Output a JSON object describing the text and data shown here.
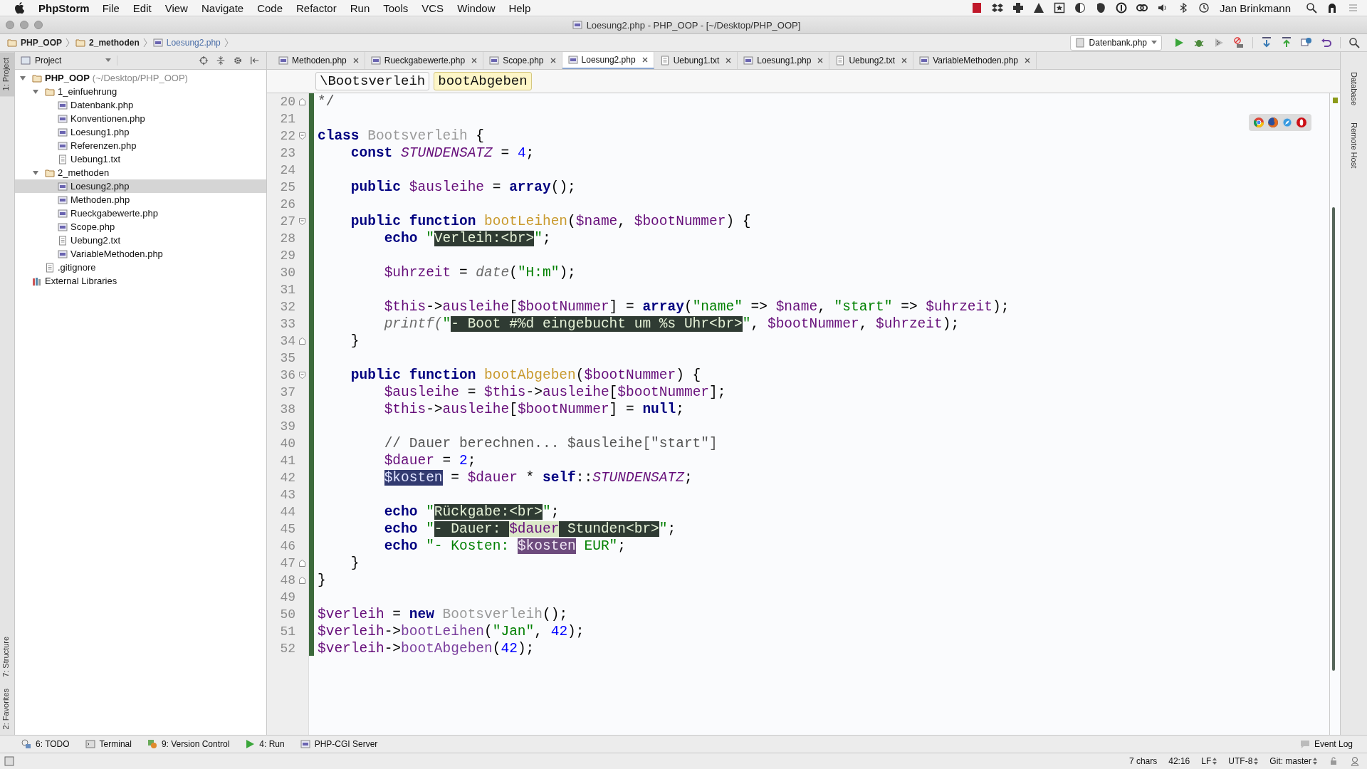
{
  "menu_bar": {
    "app": "PhpStorm",
    "items": [
      "File",
      "Edit",
      "View",
      "Navigate",
      "Code",
      "Refactor",
      "Run",
      "Tools",
      "VCS",
      "Window",
      "Help"
    ],
    "user": "Jan Brinkmann"
  },
  "window": {
    "title": "Loesung2.php - PHP_OOP - [~/Desktop/PHP_OOP]"
  },
  "breadcrumb": [
    {
      "label": "PHP_OOP",
      "kind": "folder"
    },
    {
      "label": "2_methoden",
      "kind": "folder"
    },
    {
      "label": "Loesung2.php",
      "kind": "php"
    }
  ],
  "run_config": "Datenbank.php",
  "project_panel": {
    "title": "Project",
    "tree": [
      {
        "label": "PHP_OOP",
        "hint": "(~/Desktop/PHP_OOP)",
        "kind": "root",
        "expanded": true,
        "selected": false,
        "children": [
          {
            "label": "1_einfuehrung",
            "kind": "folder",
            "expanded": true,
            "selected": false,
            "children": [
              {
                "label": "Datenbank.php",
                "kind": "php",
                "selected": false
              },
              {
                "label": "Konventionen.php",
                "kind": "php",
                "selected": false
              },
              {
                "label": "Loesung1.php",
                "kind": "php",
                "selected": false
              },
              {
                "label": "Referenzen.php",
                "kind": "php",
                "selected": false
              },
              {
                "label": "Uebung1.txt",
                "kind": "txt",
                "selected": false
              }
            ]
          },
          {
            "label": "2_methoden",
            "kind": "folder",
            "expanded": true,
            "selected": false,
            "children": [
              {
                "label": "Loesung2.php",
                "kind": "php",
                "selected": true
              },
              {
                "label": "Methoden.php",
                "kind": "php",
                "selected": false
              },
              {
                "label": "Rueckgabewerte.php",
                "kind": "php",
                "selected": false
              },
              {
                "label": "Scope.php",
                "kind": "php",
                "selected": false
              },
              {
                "label": "Uebung2.txt",
                "kind": "txt",
                "selected": false
              },
              {
                "label": "VariableMethoden.php",
                "kind": "php",
                "selected": false
              }
            ]
          },
          {
            "label": ".gitignore",
            "kind": "txt",
            "selected": false
          }
        ]
      },
      {
        "label": "External Libraries",
        "kind": "libs",
        "selected": false
      }
    ]
  },
  "side_tabs_left": [
    {
      "label": "1: Project",
      "selected": true
    },
    {
      "label": "7: Structure",
      "selected": false
    },
    {
      "label": "2: Favorites",
      "selected": false
    }
  ],
  "side_tabs_right": [
    "Database",
    "Remote Host"
  ],
  "tabs": [
    {
      "label": "Methoden.php",
      "kind": "php",
      "selected": false
    },
    {
      "label": "Rueckgabewerte.php",
      "kind": "php",
      "selected": false
    },
    {
      "label": "Scope.php",
      "kind": "php",
      "selected": false
    },
    {
      "label": "Loesung2.php",
      "kind": "php",
      "selected": true
    },
    {
      "label": "Uebung1.txt",
      "kind": "txt",
      "selected": false
    },
    {
      "label": "Loesung1.php",
      "kind": "php",
      "selected": false
    },
    {
      "label": "Uebung2.txt",
      "kind": "txt",
      "selected": false
    },
    {
      "label": "VariableMethoden.php",
      "kind": "php",
      "selected": false
    }
  ],
  "editor": {
    "breadcrumb": [
      {
        "label": "\\Bootsverleih",
        "selected": false
      },
      {
        "label": "bootAbgeben",
        "selected": true
      }
    ],
    "lines": [
      {
        "number": "20",
        "fold_end": true,
        "tokens": [
          {
            "text": "*/",
            "kind": "cmt"
          }
        ]
      },
      {
        "number": "21"
      },
      {
        "number": "22",
        "fold_start": true,
        "tokens": [
          {
            "text": "class ",
            "kind": "kw"
          },
          {
            "text": "Bootsverleih",
            "kind": "cls"
          },
          {
            "text": " {",
            "kind": "p"
          }
        ]
      },
      {
        "number": "23",
        "tokens": [
          {
            "text": "    const ",
            "kind": "kw"
          },
          {
            "text": "STUNDENSATZ",
            "kind": "const"
          },
          {
            "text": " = ",
            "kind": "p"
          },
          {
            "text": "4",
            "kind": "num"
          },
          {
            "text": ";",
            "kind": "p"
          }
        ]
      },
      {
        "number": "24"
      },
      {
        "number": "25",
        "tokens": [
          {
            "text": "    public ",
            "kind": "kw"
          },
          {
            "text": "$ausleihe",
            "kind": "var"
          },
          {
            "text": " = ",
            "kind": "p"
          },
          {
            "text": "array",
            "kind": "kw"
          },
          {
            "text": "();",
            "kind": "p"
          }
        ]
      },
      {
        "number": "26"
      },
      {
        "number": "27",
        "fold_start": true,
        "tokens": [
          {
            "text": "    public function ",
            "kind": "kw"
          },
          {
            "text": "bootLeihen",
            "kind": "fn"
          },
          {
            "text": "(",
            "kind": "p"
          },
          {
            "text": "$name",
            "kind": "var"
          },
          {
            "text": ", ",
            "kind": "p"
          },
          {
            "text": "$bootNummer",
            "kind": "var"
          },
          {
            "text": ") {",
            "kind": "p"
          }
        ]
      },
      {
        "number": "28",
        "tokens": [
          {
            "text": "        echo ",
            "kind": "kw"
          },
          {
            "text": "\"",
            "kind": "str"
          },
          {
            "text": "Verleih:<br>",
            "kind": "hl"
          },
          {
            "text": "\"",
            "kind": "str"
          },
          {
            "text": ";",
            "kind": "p"
          }
        ]
      },
      {
        "number": "29"
      },
      {
        "number": "30",
        "tokens": [
          {
            "text": "        $uhrzeit",
            "kind": "var"
          },
          {
            "text": " = ",
            "kind": "p"
          },
          {
            "text": "date",
            "kind": "bi"
          },
          {
            "text": "(",
            "kind": "p"
          },
          {
            "text": "\"H:m\"",
            "kind": "str"
          },
          {
            "text": ");",
            "kind": "p"
          }
        ]
      },
      {
        "number": "31"
      },
      {
        "number": "32",
        "tokens": [
          {
            "text": "        $this",
            "kind": "var"
          },
          {
            "text": "->",
            "kind": "p"
          },
          {
            "text": "ausleihe",
            "kind": "var"
          },
          {
            "text": "[",
            "kind": "p"
          },
          {
            "text": "$bootNummer",
            "kind": "var"
          },
          {
            "text": "] = ",
            "kind": "p"
          },
          {
            "text": "array",
            "kind": "kw"
          },
          {
            "text": "(",
            "kind": "p"
          },
          {
            "text": "\"name\"",
            "kind": "str"
          },
          {
            "text": " => ",
            "kind": "p"
          },
          {
            "text": "$name",
            "kind": "var"
          },
          {
            "text": ", ",
            "kind": "p"
          },
          {
            "text": "\"start\"",
            "kind": "str"
          },
          {
            "text": " => ",
            "kind": "p"
          },
          {
            "text": "$uhrzeit",
            "kind": "var"
          },
          {
            "text": ");",
            "kind": "p"
          }
        ]
      },
      {
        "number": "33",
        "tokens": [
          {
            "text": "        printf(",
            "kind": "bi"
          },
          {
            "text": "\"",
            "kind": "str"
          },
          {
            "text": "- Boot #%d eingebucht um %s Uhr<br>",
            "kind": "hl"
          },
          {
            "text": "\"",
            "kind": "str"
          },
          {
            "text": ", ",
            "kind": "p"
          },
          {
            "text": "$bootNummer",
            "kind": "var"
          },
          {
            "text": ", ",
            "kind": "p"
          },
          {
            "text": "$uhrzeit",
            "kind": "var"
          },
          {
            "text": ");",
            "kind": "p"
          }
        ]
      },
      {
        "number": "34",
        "fold_end": true,
        "tokens": [
          {
            "text": "    }",
            "kind": "p"
          }
        ]
      },
      {
        "number": "35"
      },
      {
        "number": "36",
        "fold_start": true,
        "tokens": [
          {
            "text": "    public function ",
            "kind": "kw"
          },
          {
            "text": "bootAbgeben",
            "kind": "fn"
          },
          {
            "text": "(",
            "kind": "p"
          },
          {
            "text": "$bootNummer",
            "kind": "var"
          },
          {
            "text": ") {",
            "kind": "p"
          }
        ]
      },
      {
        "number": "37",
        "tokens": [
          {
            "text": "        $ausleihe",
            "kind": "var"
          },
          {
            "text": " = ",
            "kind": "p"
          },
          {
            "text": "$this",
            "kind": "var"
          },
          {
            "text": "->",
            "kind": "p"
          },
          {
            "text": "ausleihe",
            "kind": "var"
          },
          {
            "text": "[",
            "kind": "p"
          },
          {
            "text": "$bootNummer",
            "kind": "var"
          },
          {
            "text": "];",
            "kind": "p"
          }
        ]
      },
      {
        "number": "38",
        "tokens": [
          {
            "text": "        $this",
            "kind": "var"
          },
          {
            "text": "->",
            "kind": "p"
          },
          {
            "text": "ausleihe",
            "kind": "var"
          },
          {
            "text": "[",
            "kind": "p"
          },
          {
            "text": "$bootNummer",
            "kind": "var"
          },
          {
            "text": "] = ",
            "kind": "p"
          },
          {
            "text": "null",
            "kind": "kw"
          },
          {
            "text": ";",
            "kind": "p"
          }
        ]
      },
      {
        "number": "39"
      },
      {
        "number": "40",
        "tokens": [
          {
            "text": "        // Dauer berechnen... $ausleihe[\"start\"]",
            "kind": "cmt"
          }
        ]
      },
      {
        "number": "41",
        "tokens": [
          {
            "text": "        $dauer",
            "kind": "var"
          },
          {
            "text": " = ",
            "kind": "p"
          },
          {
            "text": "2",
            "kind": "num"
          },
          {
            "text": ";",
            "kind": "p"
          }
        ]
      },
      {
        "number": "42",
        "tokens": [
          {
            "text": "        $kosten",
            "kind": "sel"
          },
          {
            "text": " = ",
            "kind": "p"
          },
          {
            "text": "$dauer",
            "kind": "var"
          },
          {
            "text": " * ",
            "kind": "p"
          },
          {
            "text": "self",
            "kind": "kw"
          },
          {
            "text": "::",
            "kind": "p"
          },
          {
            "text": "STUNDENSATZ",
            "kind": "const"
          },
          {
            "text": ";",
            "kind": "p"
          }
        ]
      },
      {
        "number": "43"
      },
      {
        "number": "44",
        "tokens": [
          {
            "text": "        echo ",
            "kind": "kw"
          },
          {
            "text": "\"",
            "kind": "str"
          },
          {
            "text": "Rückgabe:<br>",
            "kind": "hl"
          },
          {
            "text": "\"",
            "kind": "str"
          },
          {
            "text": ";",
            "kind": "p"
          }
        ]
      },
      {
        "number": "45",
        "tokens": [
          {
            "text": "        echo ",
            "kind": "kw"
          },
          {
            "text": "\"",
            "kind": "str"
          },
          {
            "text": "- Dauer: ",
            "kind": "hl"
          },
          {
            "text": "$dauer",
            "kind": "instr"
          },
          {
            "text": " Stunden<br>",
            "kind": "hl"
          },
          {
            "text": "\"",
            "kind": "str"
          },
          {
            "text": ";",
            "kind": "p"
          }
        ]
      },
      {
        "number": "46",
        "tokens": [
          {
            "text": "        echo ",
            "kind": "kw"
          },
          {
            "text": "\"- Kosten: ",
            "kind": "str"
          },
          {
            "text": "$kosten",
            "kind": "sel2"
          },
          {
            "text": " EUR\"",
            "kind": "str"
          },
          {
            "text": ";",
            "kind": "p"
          }
        ]
      },
      {
        "number": "47",
        "fold_end": true,
        "tokens": [
          {
            "text": "    }",
            "kind": "p"
          }
        ]
      },
      {
        "number": "48",
        "fold_end": true,
        "tokens": [
          {
            "text": "}",
            "kind": "p"
          }
        ]
      },
      {
        "number": "49"
      },
      {
        "number": "50",
        "tokens": [
          {
            "text": "$verleih",
            "kind": "var"
          },
          {
            "text": " = ",
            "kind": "p"
          },
          {
            "text": "new ",
            "kind": "kw"
          },
          {
            "text": "Bootsverleih",
            "kind": "cls"
          },
          {
            "text": "();",
            "kind": "p"
          }
        ]
      },
      {
        "number": "51",
        "tokens": [
          {
            "text": "$verleih",
            "kind": "var"
          },
          {
            "text": "->",
            "kind": "p"
          },
          {
            "text": "bootLeihen",
            "kind": "call"
          },
          {
            "text": "(",
            "kind": "p"
          },
          {
            "text": "\"Jan\"",
            "kind": "str"
          },
          {
            "text": ", ",
            "kind": "p"
          },
          {
            "text": "42",
            "kind": "num"
          },
          {
            "text": ");",
            "kind": "p"
          }
        ]
      },
      {
        "number": "52",
        "tokens": [
          {
            "text": "$verleih",
            "kind": "var"
          },
          {
            "text": "->",
            "kind": "p"
          },
          {
            "text": "bootAbgeben",
            "kind": "call"
          },
          {
            "text": "(",
            "kind": "p"
          },
          {
            "text": "42",
            "kind": "num"
          },
          {
            "text": ");",
            "kind": "p"
          }
        ]
      }
    ]
  },
  "tool_windows": [
    {
      "label": "6: TODO",
      "kind": "todo"
    },
    {
      "label": "Terminal",
      "kind": "terminal"
    },
    {
      "label": "9: Version Control",
      "kind": "vcs"
    },
    {
      "label": "4: Run",
      "kind": "run"
    },
    {
      "label": "PHP-CGI Server",
      "kind": "php"
    }
  ],
  "event_log": "Event Log",
  "status_bar": [
    {
      "label": "7 chars",
      "kind": "text"
    },
    {
      "label": "42:16",
      "kind": "text"
    },
    {
      "label": "LF",
      "kind": "select"
    },
    {
      "label": "UTF-8",
      "kind": "select"
    },
    {
      "label": "Git: master",
      "kind": "select"
    }
  ]
}
